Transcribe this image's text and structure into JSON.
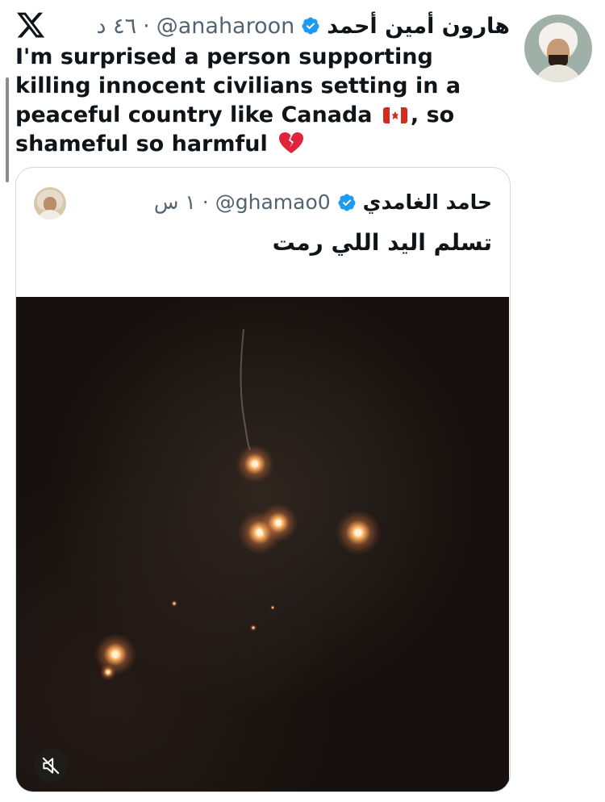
{
  "header": {
    "display_name": "هارون أمين أحمد",
    "handle": "@anaharoon",
    "separator": "·",
    "time": "٤٦ د"
  },
  "tweet": {
    "text_before_flag": "I'm surprised a person supporting killing innocent civilians setting in a peaceful country like Canada ",
    "text_after_flag": ",  so shameful so harmful "
  },
  "quoted_tweet": {
    "display_name": "حامد الغامدي",
    "handle": "@ghamao0",
    "separator": "·",
    "time": "١ س",
    "text": "تسلم اليد اللي رمت"
  },
  "icons": {
    "logo": "x-logo-icon",
    "verified": "verified-badge-icon",
    "flag": "canada-flag-icon",
    "emoji": "broken-heart-icon",
    "mute": "muted-speaker-icon"
  },
  "colors": {
    "text": "#0f1419",
    "secondary": "#536471",
    "verified_blue": "#1d9bf0",
    "border": "#cfd9de"
  }
}
